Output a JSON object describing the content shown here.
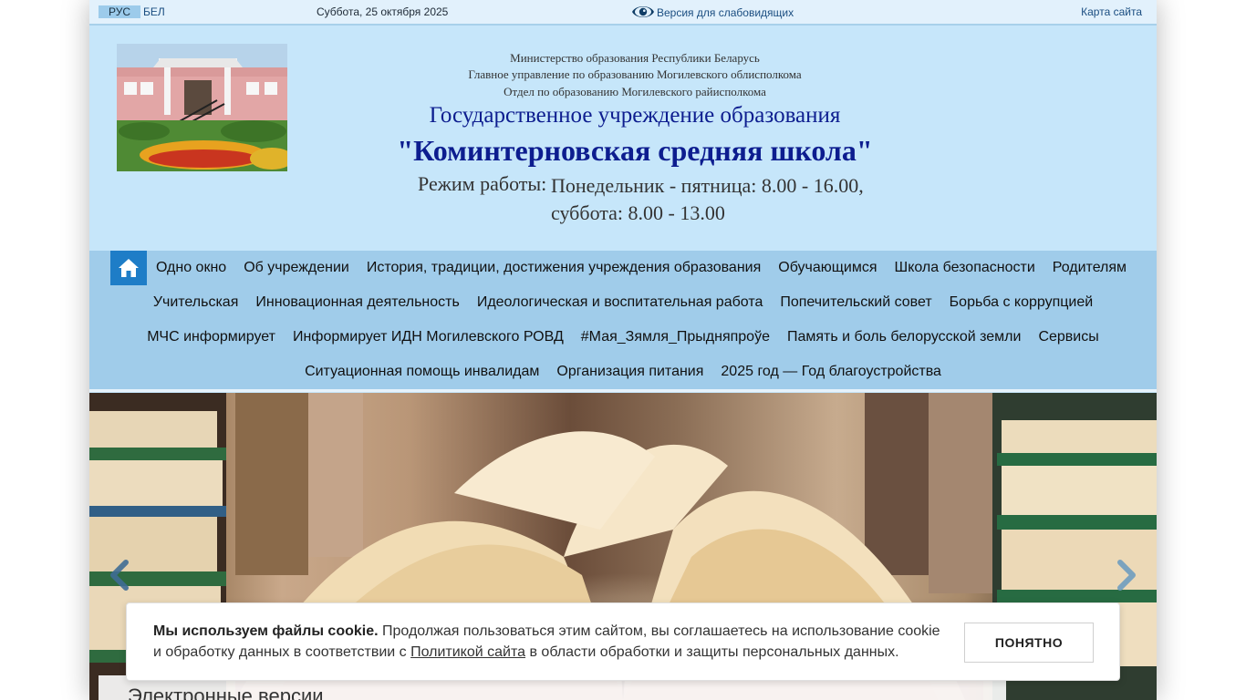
{
  "topbar": {
    "lang_rus": "РУС",
    "lang_bel": "БЕЛ",
    "date": "Суббота, 25 октября 2025",
    "vision_link": "Версия для слабовидящих",
    "sitemap": "Карта сайта"
  },
  "header": {
    "ministry_lines": [
      "Министерство образования Республики Беларусь",
      "Главное управление по образованию Могилевского облисполкома",
      "Отдел по образованию Могилевского райисполкома"
    ],
    "org_type": "Государственное учреждение образования",
    "school_name": "\"Коминтерновская средняя школа\"",
    "hours_label": "Режим работы:",
    "hours_line1": "Понедельник - пятница: 8.00 - 16.00,",
    "hours_line2": "суббота: 8.00 - 13.00"
  },
  "nav": {
    "rows": [
      [
        "Одно окно",
        "Об учреждении",
        "История, традиции, достижения учреждения образования",
        "Обучающимся",
        "Школа безопасности",
        "Родителям"
      ],
      [
        "Учительская",
        "Инновационная деятельность",
        "Идеологическая и воспитательная работа",
        "Попечительский совет",
        "Борьба с коррупцией"
      ],
      [
        "МЧС информирует",
        "Информирует ИДН Могилевского РОВД",
        "#Мая_Зямля_Прыдняпроўе",
        "Память и боль белорусской земли",
        "Сервисы"
      ],
      [
        "Ситуационная помощь инвалидам",
        "Организация питания",
        "2025 год — Год благоустройства"
      ]
    ]
  },
  "slider": {
    "panel_title": "Электронные версии"
  },
  "cookie": {
    "bold": "Мы используем файлы cookie.",
    "text1": " Продолжая пользоваться этим сайтом, вы соглашаетесь на использование cookie и обработку данных в соответствии с ",
    "link": "Политикой сайта",
    "text2": " в области обработки и защиты персональных данных.",
    "button": "ПОНЯТНО"
  },
  "icons": {
    "home": "home-icon",
    "eye": "eye-icon",
    "prev": "chevron-left-icon",
    "next": "chevron-right-icon"
  },
  "colors": {
    "page_bg": "#c6e6fa",
    "nav_bg": "#a0ccea",
    "home_btn": "#1e7dc7",
    "title": "#0d1d8f"
  }
}
